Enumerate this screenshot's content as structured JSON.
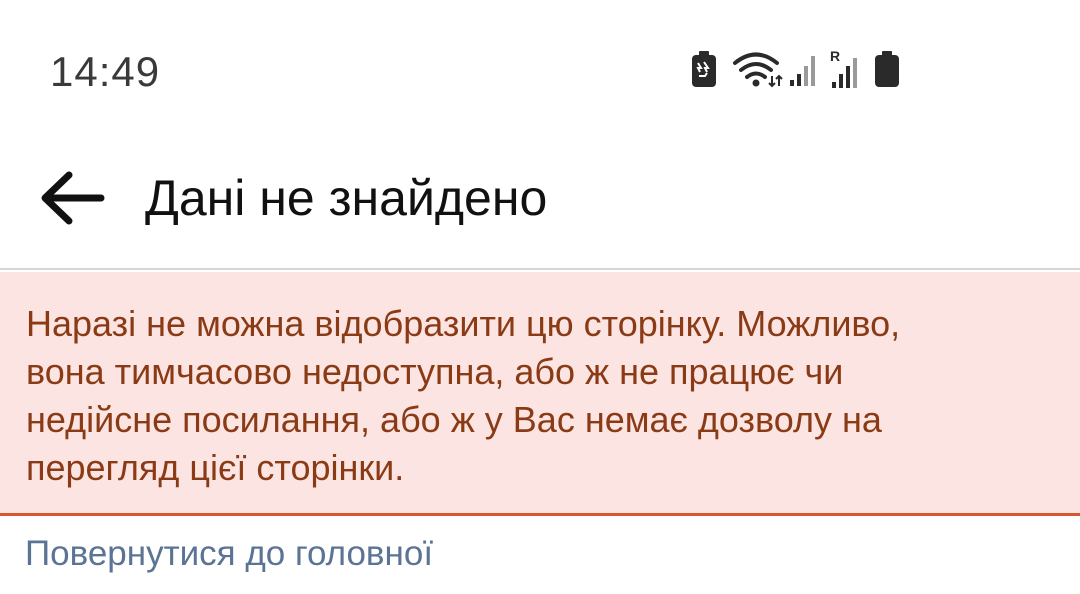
{
  "status_bar": {
    "time": "14:49",
    "icons": [
      "battery-saver-icon",
      "wifi-icon",
      "signal-icon",
      "roaming-signal-icon",
      "battery-icon"
    ],
    "roaming_label": "R"
  },
  "header": {
    "back_icon": "arrow-left-icon",
    "title": "Дані не знайдено"
  },
  "error": {
    "lines": [
      "Наразі не можна відобразити цю сторінку. Можливо,",
      "вона тимчасово недоступна, або ж не працює чи",
      "недійсне посилання, або ж у Вас немає дозволу на",
      "перегляд цієї сторінки."
    ],
    "background": "#fbe4e1",
    "text_color": "#8a3a15",
    "border_color": "#d8572f"
  },
  "link": {
    "label": "Повернутися до головної",
    "color": "#5b7394"
  }
}
